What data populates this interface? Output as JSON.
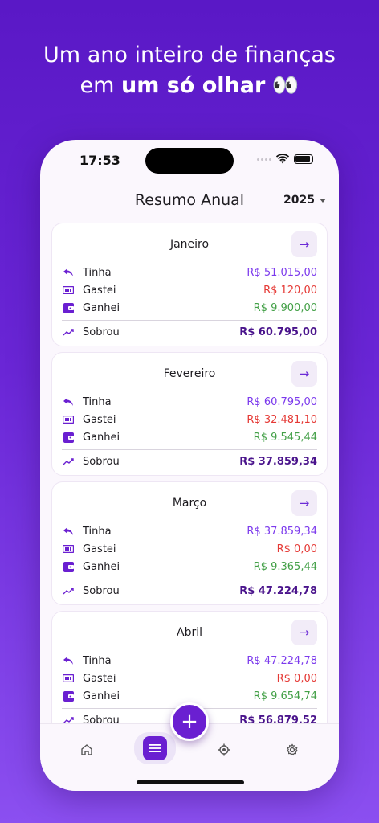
{
  "headline": {
    "line1": "Um ano inteiro de finanças",
    "line2_prefix": "em ",
    "line2_bold": "um só olhar",
    "line2_emoji": "👀"
  },
  "status": {
    "time": "17:53"
  },
  "header": {
    "title": "Resumo Anual",
    "year": "2025"
  },
  "labels": {
    "tinha": "Tinha",
    "gastei": "Gastei",
    "ganhei": "Ganhei",
    "sobrou": "Sobrou"
  },
  "months": [
    {
      "name": "Janeiro",
      "tinha": "R$ 51.015,00",
      "gastei": "R$ 120,00",
      "ganhei": "R$ 9.900,00",
      "sobrou": "R$ 60.795,00"
    },
    {
      "name": "Fevereiro",
      "tinha": "R$ 60.795,00",
      "gastei": "R$ 32.481,10",
      "ganhei": "R$ 9.545,44",
      "sobrou": "R$ 37.859,34"
    },
    {
      "name": "Março",
      "tinha": "R$ 37.859,34",
      "gastei": "R$ 0,00",
      "ganhei": "R$ 9.365,44",
      "sobrou": "R$ 47.224,78"
    },
    {
      "name": "Abril",
      "tinha": "R$ 47.224,78",
      "gastei": "R$ 0,00",
      "ganhei": "R$ 9.654,74",
      "sobrou": "R$ 56.879,52"
    }
  ],
  "colors": {
    "accent": "#6a1fd1",
    "positive": "#43a047",
    "negative": "#e53935",
    "neutral": "#7c3aed"
  },
  "nav": [
    "home-icon",
    "list-icon",
    "target-icon",
    "gear-icon"
  ],
  "fab": {
    "icon": "plus-icon",
    "label": "+"
  }
}
